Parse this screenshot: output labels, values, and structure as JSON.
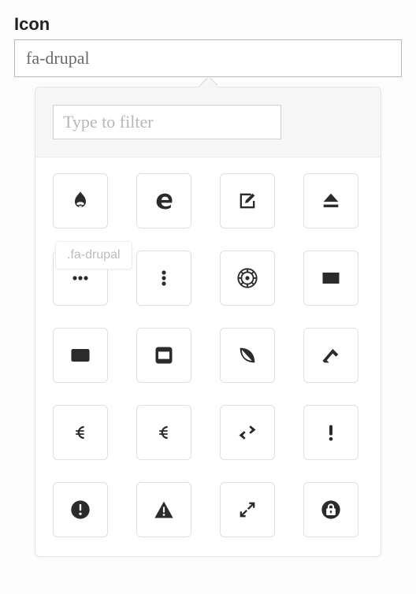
{
  "field": {
    "label": "Icon",
    "value": "fa-drupal"
  },
  "filter": {
    "placeholder": "Type to filter",
    "value": ""
  },
  "tooltip": ".fa-drupal",
  "icons": [
    {
      "name": "drupal-icon"
    },
    {
      "name": "edge-icon"
    },
    {
      "name": "edit-icon"
    },
    {
      "name": "eject-icon"
    },
    {
      "name": "ellipsis-h-icon"
    },
    {
      "name": "ellipsis-v-icon"
    },
    {
      "name": "empire-icon"
    },
    {
      "name": "envelope-icon"
    },
    {
      "name": "envelope-o-icon"
    },
    {
      "name": "envelope-square-icon"
    },
    {
      "name": "envira-icon"
    },
    {
      "name": "eraser-icon"
    },
    {
      "name": "eur-icon"
    },
    {
      "name": "euro-icon"
    },
    {
      "name": "exchange-icon"
    },
    {
      "name": "exclamation-icon"
    },
    {
      "name": "exclamation-circle-icon"
    },
    {
      "name": "exclamation-triangle-icon"
    },
    {
      "name": "expand-icon"
    },
    {
      "name": "expeditedssl-icon"
    }
  ]
}
